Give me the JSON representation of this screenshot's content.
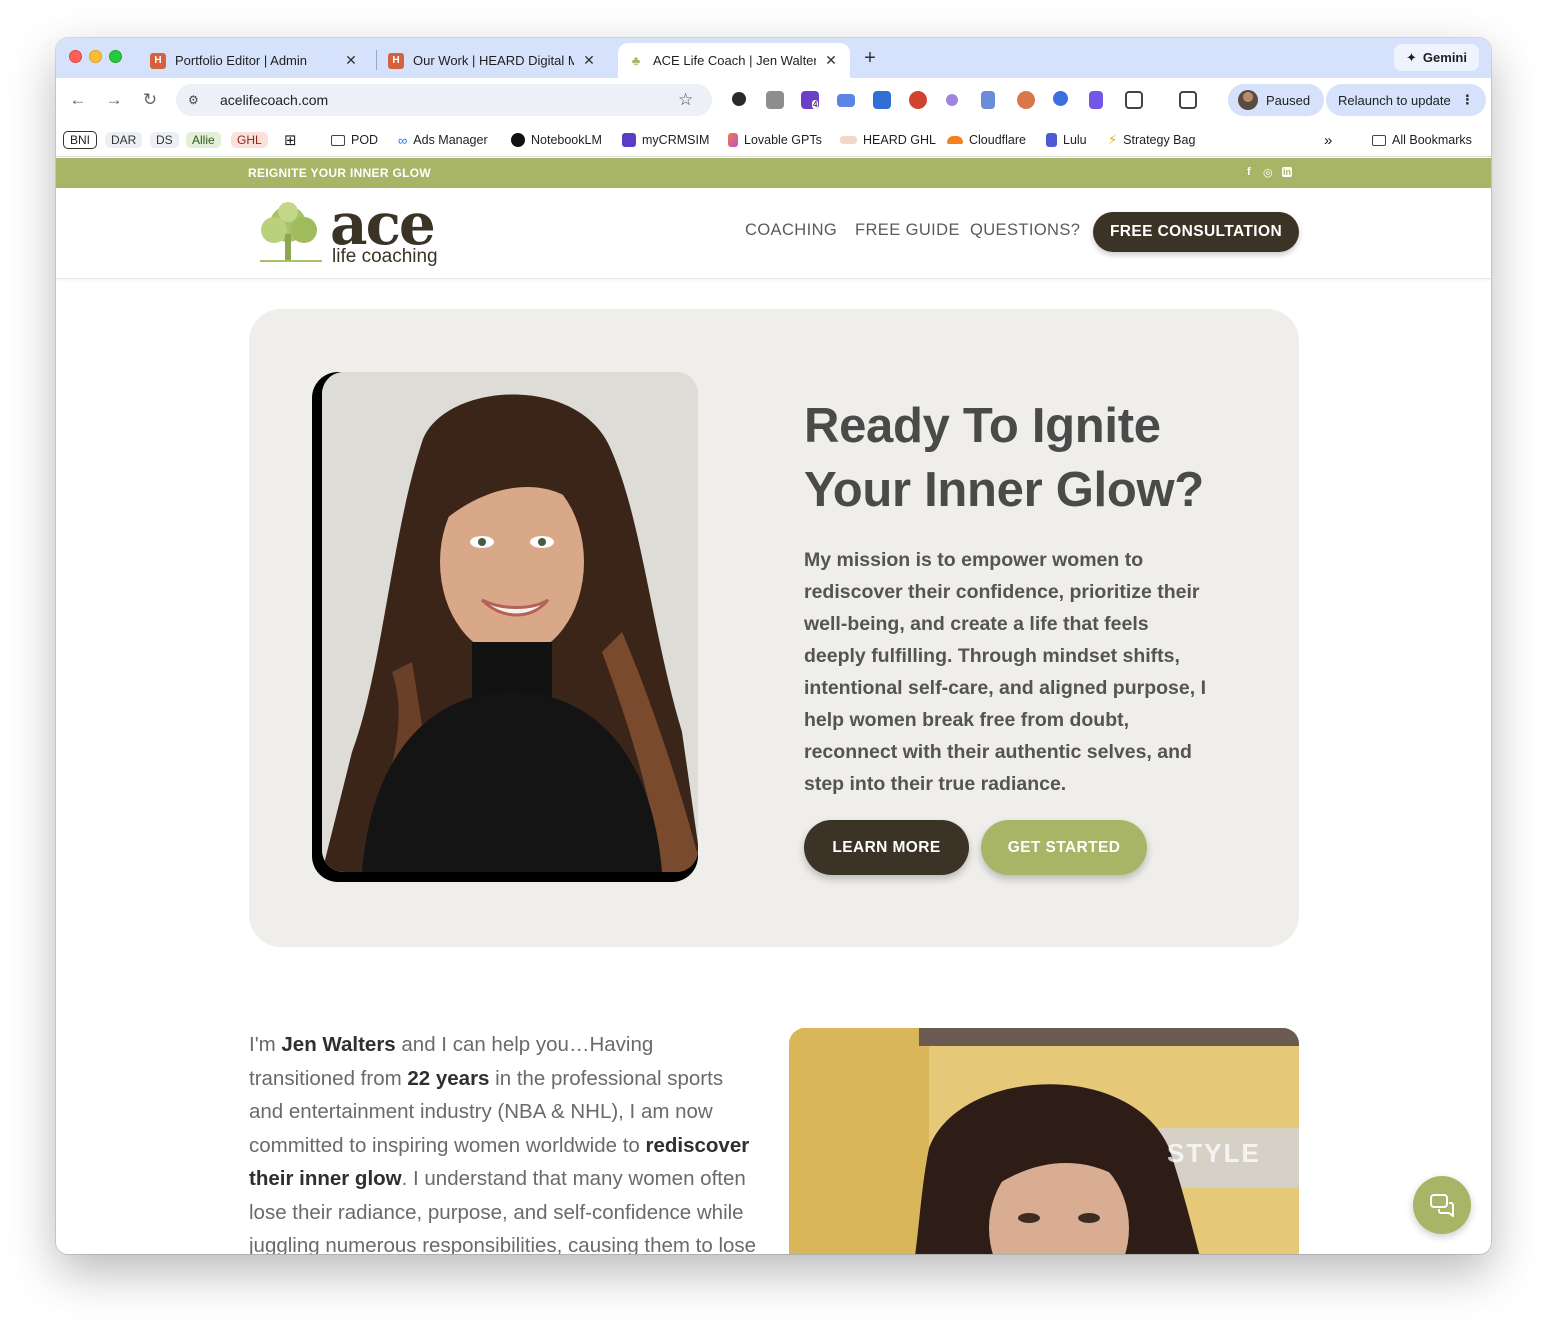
{
  "browser": {
    "tabs": [
      {
        "title": "Portfolio Editor | Admin",
        "favicon": "heard-h-icon"
      },
      {
        "title": "Our Work | HEARD Digital Mar",
        "favicon": "heard-h-icon"
      },
      {
        "title": "ACE Life Coach | Jen Walters",
        "favicon": "ace-tree-icon",
        "active": true
      }
    ],
    "new_tab_label": "+",
    "gemini_label": "Gemini",
    "url": "acelifecoach.com",
    "profile_label": "Paused",
    "relaunch_label": "Relaunch to update",
    "bookmarks": [
      {
        "label": "BNI",
        "style": "outline"
      },
      {
        "label": "DAR",
        "style": "grey"
      },
      {
        "label": "DS",
        "style": "grey"
      },
      {
        "label": "Allie",
        "style": "green"
      },
      {
        "label": "GHL",
        "style": "red"
      },
      {
        "label": "POD",
        "icon": "folder-icon"
      },
      {
        "label": "Ads Manager",
        "icon": "meta-icon"
      },
      {
        "label": "NotebookLM",
        "icon": "notebooklm-icon"
      },
      {
        "label": "myCRMSIM",
        "icon": "crm-icon"
      },
      {
        "label": "Lovable GPTs",
        "icon": "lovable-icon"
      },
      {
        "label": "HEARD GHL",
        "icon": "heard-icon"
      },
      {
        "label": "Cloudflare",
        "icon": "cloudflare-icon"
      },
      {
        "label": "Lulu",
        "icon": "lulu-icon"
      },
      {
        "label": "Strategy Bag",
        "icon": "bolt-icon"
      }
    ],
    "more_bookmarks": "»",
    "all_bookmarks": "All Bookmarks",
    "extension_badge": "4"
  },
  "site": {
    "topbar_tagline": "REIGNITE YOUR INNER GLOW",
    "social": [
      "f",
      "◎",
      "in"
    ],
    "logo_word": "ace",
    "logo_sub": "life coaching",
    "nav": [
      "COACHING",
      "FREE GUIDE",
      "QUESTIONS?"
    ],
    "cta": "FREE CONSULTATION",
    "hero": {
      "title": "Ready To Ignite Your Inner Glow?",
      "text": "My mission is to empower women to rediscover their confidence, prioritize their well-being, and create a life that feels deeply fulfilling. Through mindset shifts, intentional self-care, and aligned purpose, I help women break free from doubt, reconnect with their authentic selves, and step into their true radiance.",
      "btn_learn": "LEARN MORE",
      "btn_start": "GET STARTED"
    },
    "intro": {
      "p1": "I'm ",
      "name": "Jen Walters",
      "p2": " and I can help you…Having transitioned from ",
      "years": "22 years",
      "p3": " in the professional sports and entertainment industry (NBA & NHL), I am now committed to inspiring women worldwide to ",
      "glow": "rediscover their inner glow",
      "p4": ". I understand that many women often lose their radiance, purpose, and self-confidence while juggling numerous responsibilities, causing them to lose"
    },
    "video_overlay": "STYLE",
    "colors": {
      "olive": "#a8b567",
      "dark": "#3b3326",
      "hero_bg": "#efeeea"
    }
  }
}
